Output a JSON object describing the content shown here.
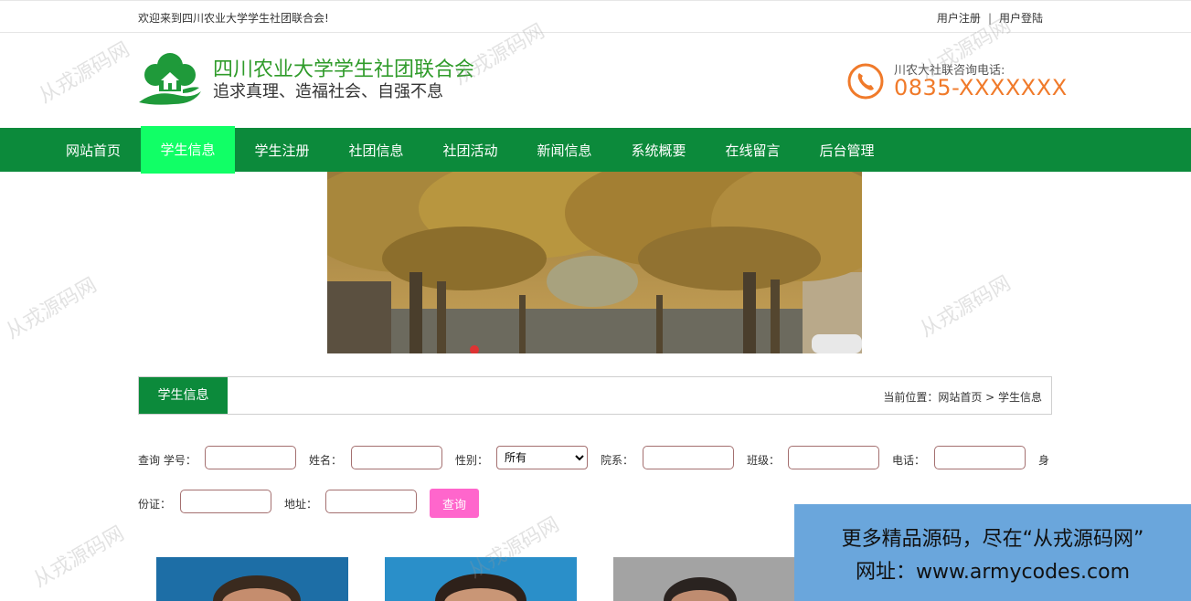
{
  "topbar": {
    "welcome": "欢迎来到四川农业大学学生社团联合会!",
    "register": "用户注册",
    "separator": "|",
    "login": "用户登陆"
  },
  "header": {
    "site_name": "四川农业大学学生社团联合会",
    "slogan": "追求真理、造福社会、自强不息",
    "phone_label": "川农大社联咨询电话:",
    "phone_number": "0835-XXXXXXX"
  },
  "nav": [
    {
      "label": "网站首页"
    },
    {
      "label": "学生信息",
      "active": true
    },
    {
      "label": "学生注册"
    },
    {
      "label": "社团信息"
    },
    {
      "label": "社团活动"
    },
    {
      "label": "新闻信息"
    },
    {
      "label": "系统概要"
    },
    {
      "label": "在线留言"
    },
    {
      "label": "后台管理"
    }
  ],
  "section": {
    "title": "学生信息",
    "breadcrumb": "当前位置：网站首页 > 学生信息"
  },
  "search": {
    "label_student_no": "查询 学号：",
    "label_name": "姓名：",
    "label_gender": "性别：",
    "gender_selected": "所有",
    "label_department": "院系：",
    "label_class": "班级：",
    "label_phone": "电话：",
    "label_id_1": "身",
    "label_id_2": "份证：",
    "label_address": "地址：",
    "button": "查询"
  },
  "promo": {
    "line1": "更多精品源码，尽在“从戎源码网”",
    "line2": "网址：www.armycodes.com"
  },
  "watermark": "从戎源码网",
  "colors": {
    "nav_bg": "#0c8a3b",
    "nav_active": "#11ff66",
    "site_name": "#2f9b2a",
    "phone": "#f07a2a",
    "query_button": "#ff66cc",
    "promo_bg": "#6aa6dc"
  }
}
